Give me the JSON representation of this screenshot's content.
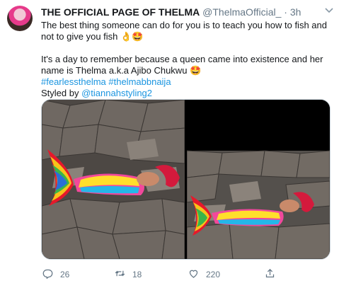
{
  "tweet": {
    "display_name": "THE OFFICIAL PAGE OF THELMA",
    "handle": "@ThelmaOfficial_",
    "separator": "·",
    "time": "3h",
    "line1": "The best thing someone can do for you is to teach you how to fish and not to give you fish 👌🤩",
    "line2": "It's a day to remember because a queen came into existence and her name is Thelma a.k.a Ajibo Chukwu 🤩",
    "hashtags": "#fearlessthelma #thelmabbnaija",
    "styled_by_label": "Styled by ",
    "styled_by_handle": "@tiannahstyling2"
  },
  "media": {
    "photo1_alt": "Woman in rainbow mermaid tail lying on rocks",
    "photo2_alt": "Woman in rainbow mermaid tail lying on rocks, wider shot"
  },
  "actions": {
    "reply_count": "26",
    "retweet_count": "18",
    "like_count": "220"
  },
  "icons": {
    "reply": "reply-icon",
    "retweet": "retweet-icon",
    "like": "heart-icon",
    "share": "share-icon",
    "more": "chevron-down-icon"
  },
  "colors": {
    "link": "#1b95e0",
    "text": "#14171a",
    "muted": "#657786"
  }
}
